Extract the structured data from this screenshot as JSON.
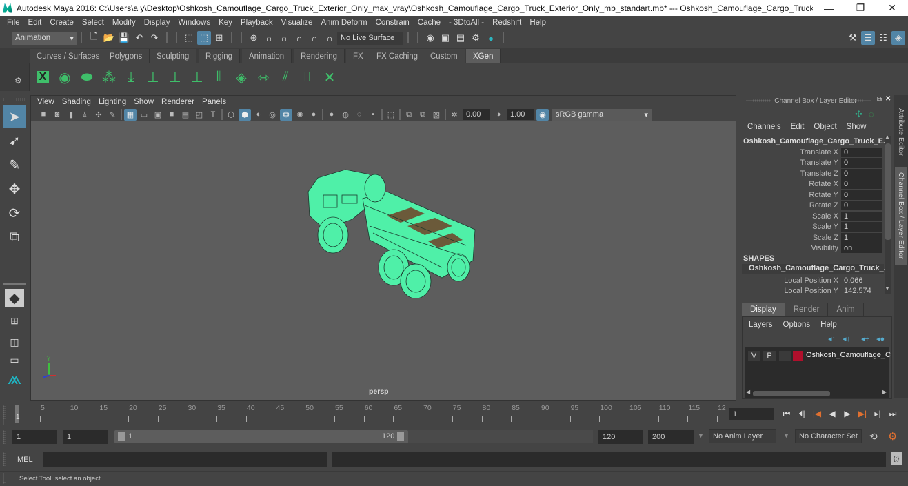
{
  "window": {
    "title": "Autodesk Maya 2016: C:\\Users\\a y\\Desktop\\Oshkosh_Camouflage_Cargo_Truck_Exterior_Only_max_vray\\Oshkosh_Camouflage_Cargo_Truck_Exterior_Only_mb_standart.mb*  ---  Oshkosh_Camouflage_Cargo_Truck_Exterior_...",
    "minimize": "—",
    "restore": "❐",
    "close": "✕"
  },
  "menubar": [
    "File",
    "Edit",
    "Create",
    "Select",
    "Modify",
    "Display",
    "Windows",
    "Key",
    "Playback",
    "Visualize",
    "Anim Deform",
    "Constrain",
    "Cache",
    "- 3DtoAll -",
    "Redshift",
    "Help"
  ],
  "statusline": {
    "mode": "Animation",
    "live_surface": "No Live Surface"
  },
  "shelf": {
    "tabs": [
      "Curves / Surfaces",
      "Polygons",
      "Sculpting",
      "Rigging",
      "Animation",
      "Rendering",
      "FX",
      "FX Caching",
      "Custom",
      "XGen"
    ],
    "active_tab": "XGen",
    "icons": [
      "xgen-window-icon",
      "xgen-preview-icon",
      "xgen-clear-preview-icon",
      "add-guides-icon",
      "sculpt-guides-icon",
      "add-guide-icon",
      "select-guide-icon",
      "lock-guide-icon",
      "guides-to-curves-icon",
      "region-map-icon",
      "guide-length-icon",
      "flip-guides-icon",
      "select-guides-icon",
      "delete-guide-icon"
    ]
  },
  "viewport": {
    "menu": [
      "View",
      "Shading",
      "Lighting",
      "Show",
      "Renderer",
      "Panels"
    ],
    "exposure": "0.00",
    "gamma": "1.00",
    "color_space": "sRGB gamma",
    "camera_label": "persp",
    "axis": {
      "y": "Y",
      "x": "X",
      "z": "Z"
    }
  },
  "channelbox": {
    "header": "Channel Box / Layer Editor",
    "menu": [
      "Channels",
      "Edit",
      "Object",
      "Show"
    ],
    "object_name": "Oshkosh_Camouflage_Cargo_Truck_E...",
    "channels": [
      {
        "label": "Translate X",
        "value": "0"
      },
      {
        "label": "Translate Y",
        "value": "0"
      },
      {
        "label": "Translate Z",
        "value": "0"
      },
      {
        "label": "Rotate X",
        "value": "0"
      },
      {
        "label": "Rotate Y",
        "value": "0"
      },
      {
        "label": "Rotate Z",
        "value": "0"
      },
      {
        "label": "Scale X",
        "value": "1"
      },
      {
        "label": "Scale Y",
        "value": "1"
      },
      {
        "label": "Scale Z",
        "value": "1"
      },
      {
        "label": "Visibility",
        "value": "on"
      }
    ],
    "shapes_header": "SHAPES",
    "shape_name": "Oshkosh_Camouflage_Cargo_Truck_...",
    "shape_channels": [
      {
        "label": "Local Position X",
        "value": "0.066"
      },
      {
        "label": "Local Position Y",
        "value": "142.574"
      }
    ]
  },
  "side_tabs": [
    "Attribute Editor",
    "Channel Box / Layer Editor"
  ],
  "layer_editor": {
    "tabs": [
      "Display",
      "Render",
      "Anim"
    ],
    "active_tab": "Display",
    "menu": [
      "Layers",
      "Options",
      "Help"
    ],
    "layers": [
      {
        "v": "V",
        "p": "P",
        "color": "#b0102c",
        "name": "Oshkosh_Camouflage_C"
      }
    ]
  },
  "timeline": {
    "ticks": [
      "5",
      "10",
      "15",
      "20",
      "25",
      "30",
      "35",
      "40",
      "45",
      "50",
      "55",
      "60",
      "65",
      "70",
      "75",
      "80",
      "85",
      "90",
      "95",
      "100",
      "105",
      "110",
      "115",
      "12"
    ],
    "current_marker": "1",
    "current_frame": "1"
  },
  "range": {
    "start": "1",
    "playback_start": "1",
    "slider_start": "1",
    "slider_end": "120",
    "playback_end": "120",
    "end": "200",
    "anim_layer": "No Anim Layer",
    "character_set": "No Character Set"
  },
  "command": {
    "language": "MEL"
  },
  "helpline": "Select Tool: select an object"
}
